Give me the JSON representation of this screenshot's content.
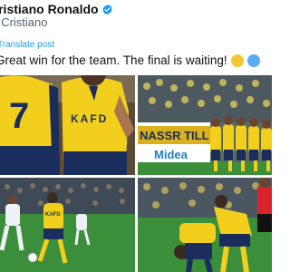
{
  "author": {
    "display_name": "Cristiano Ronaldo",
    "handle": "@Cristiano",
    "verified": true,
    "verified_color": "#1d9bf0"
  },
  "tweet": {
    "translate_label": "Translate post",
    "text": "Great win for the team. The final is waiting!",
    "emojis": [
      "yellow-heart",
      "blue-circle"
    ],
    "link_color": "#1d9bf0"
  },
  "media": {
    "photos": [
      {
        "name": "photo-players-back-view",
        "jersey_number": "7",
        "sponsor": "KAFD"
      },
      {
        "name": "photo-team-huddle",
        "stadium_signage": "NASSR TILL",
        "banner_text": "Midea"
      },
      {
        "name": "photo-player-dribbling",
        "sponsor": "KAFD"
      },
      {
        "name": "photo-players-celebrating"
      }
    ]
  },
  "colors": {
    "nassr_yellow": "#f2cf1d",
    "nassr_navy": "#1b2d5c",
    "pitch_green": "#3c8f3a",
    "text_secondary": "#536471"
  }
}
